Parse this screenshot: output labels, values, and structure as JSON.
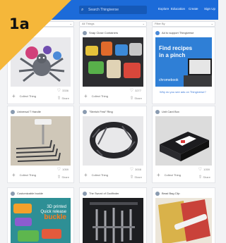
{
  "header": {
    "search_placeholder": "Search Thingiverse",
    "nav": [
      "Explore",
      "Education",
      "Create",
      "Sign Up"
    ]
  },
  "badge": {
    "label": "1a",
    "color": "#f5b73a"
  },
  "filters": [
    "All Things",
    "Filter By"
  ],
  "ad": {
    "title_1": "Find recipes",
    "title_2": "in a pinch",
    "brand": "chromebook",
    "header": "Ad to support Thingiverse",
    "link": "Why do you see ads on Thingiverse?"
  },
  "cards": [
    {
      "header": "",
      "likes": "3336"
    },
    {
      "header": "Snap Close Containers",
      "likes": "3277"
    },
    {
      "header": "Universal T Handle",
      "likes": "1059"
    },
    {
      "header": "\"Stretch Fest\" Ring",
      "likes": "3008"
    },
    {
      "header": "Unit Card Box",
      "likes": "1059"
    },
    {
      "header": "Customizable buckle"
    },
    {
      "header": "The Sword of Godfinder"
    },
    {
      "header": "Bead Bag Clip"
    }
  ],
  "card_actions": {
    "collect": "Collect Thing",
    "share": "Share"
  },
  "buckle": {
    "line1": "3D printed",
    "line2": "Quick release",
    "line3": "buckle"
  }
}
